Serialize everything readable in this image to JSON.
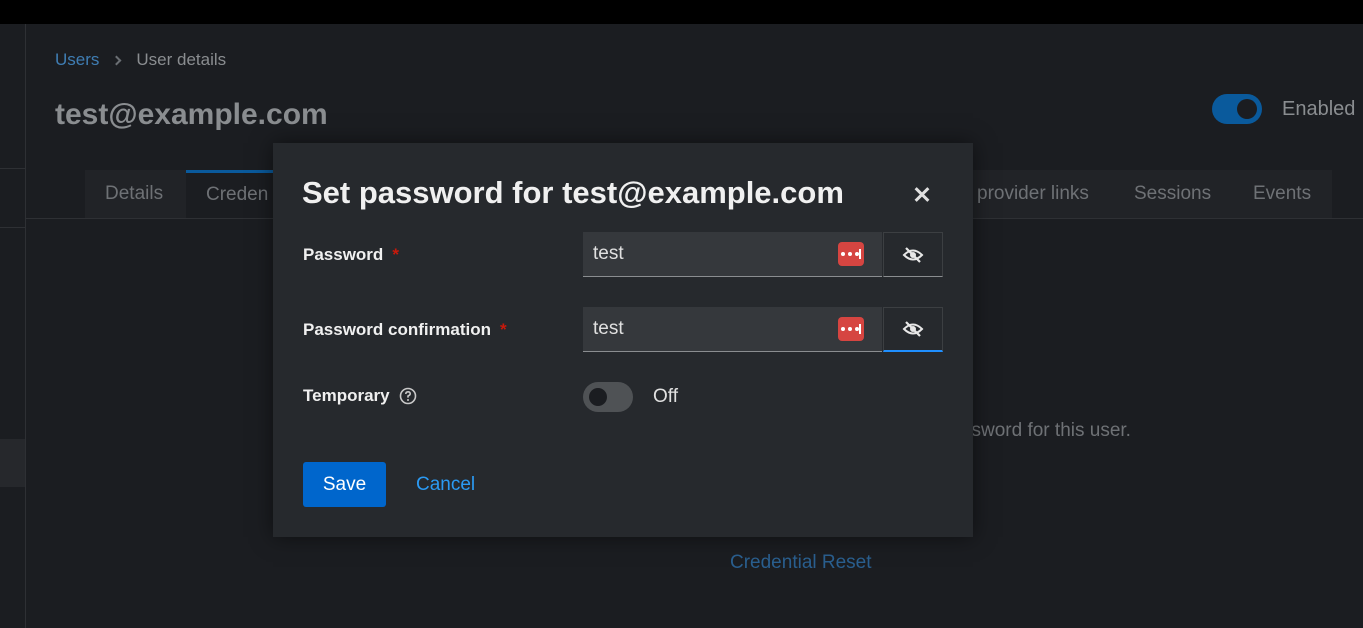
{
  "breadcrumb": {
    "parent": "Users",
    "current": "User details"
  },
  "page": {
    "title": "test@example.com",
    "enabled_label": "Enabled",
    "enabled": true
  },
  "tabs": [
    {
      "label": "Details"
    },
    {
      "label": "Creden",
      "active": true
    },
    {
      "label": "provider links"
    },
    {
      "label": "Sessions"
    },
    {
      "label": "Events"
    }
  ],
  "background": {
    "hint_text": "ssword for this user.",
    "link_text": "Credential Reset"
  },
  "modal": {
    "title": "Set password for test@example.com",
    "password": {
      "label": "Password",
      "required_mark": "*",
      "value": "test"
    },
    "confirmation": {
      "label": "Password confirmation",
      "required_mark": "*",
      "value": "test"
    },
    "temporary": {
      "label": "Temporary",
      "state_label": "Off",
      "on": false
    },
    "save_label": "Save",
    "cancel_label": "Cancel"
  },
  "icons": {
    "close": "close-icon",
    "password_manager": "password-manager-icon",
    "visibility": "eye-slash-icon",
    "help": "question-circle-icon"
  },
  "colors": {
    "primary": "#0066cc",
    "link": "#2b9af3",
    "required": "#c9190b",
    "password_manager": "#d64541"
  }
}
